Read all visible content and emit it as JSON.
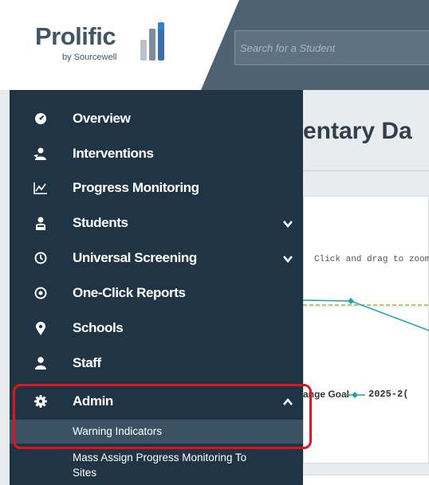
{
  "header": {
    "logo_name": "Prolific",
    "logo_sub": "by Sourcewell",
    "search_placeholder": "Search for a Student"
  },
  "main": {
    "title_fragment": "entary Da",
    "zoom_hint": "Click and drag to zoom",
    "legend_goal": "ange Goal",
    "legend_series": "2025-2("
  },
  "sidebar": {
    "items": [
      {
        "label": "Overview",
        "icon": "gauge-icon"
      },
      {
        "label": "Interventions",
        "icon": "people-icon"
      },
      {
        "label": "Progress Monitoring",
        "icon": "line-chart-icon"
      },
      {
        "label": "Students",
        "icon": "student-icon"
      },
      {
        "label": "Universal Screening",
        "icon": "stopwatch-icon"
      },
      {
        "label": "One-Click Reports",
        "icon": "target-icon"
      },
      {
        "label": "Schools",
        "icon": "map-pin-icon"
      },
      {
        "label": "Staff",
        "icon": "user-icon"
      },
      {
        "label": "Admin",
        "icon": "gear-icon"
      }
    ],
    "admin_sub": [
      {
        "label": "Warning Indicators"
      },
      {
        "label": "Mass Assign Progress Monitoring To"
      },
      {
        "label": "Sites"
      }
    ]
  },
  "colors": {
    "sidebar_bg": "#1f3444",
    "sub_active_bg": "#3b5264",
    "highlight": "#e0141e",
    "series_line": "#1aa3a8",
    "goal_line": "#9bb53a"
  }
}
